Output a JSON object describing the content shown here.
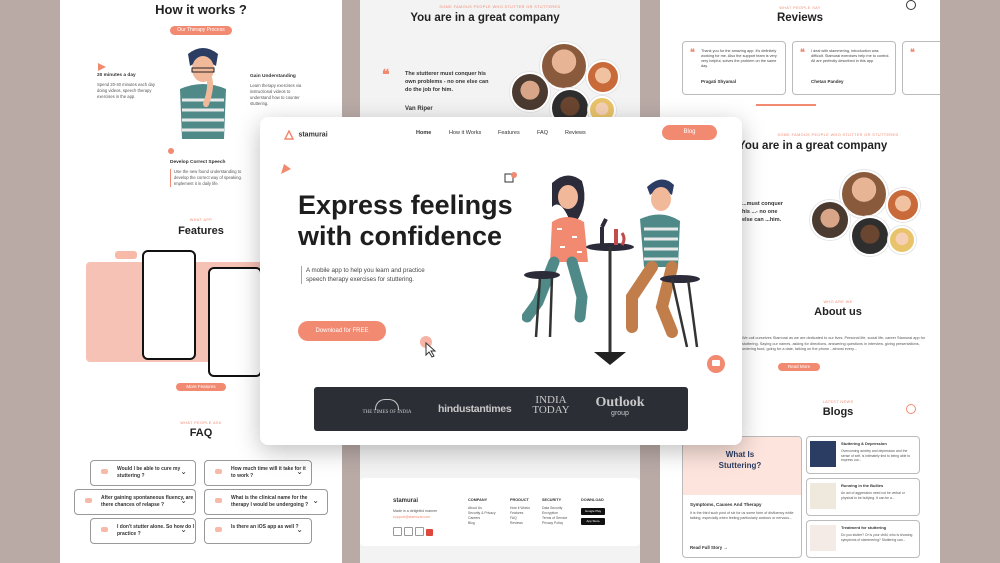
{
  "left": {
    "how_title": "How it works ?",
    "how_pill": "Our Therapy Process",
    "steps": [
      {
        "title": "20 minutes a day",
        "text": "Spend 20-40 minutes each day doing videos, speech therapy exercises in the app."
      },
      {
        "title": "Gain Understanding",
        "text": "Learn therapy exercises via instructional videos to understand how to counter stuttering."
      },
      {
        "title": "Develop Correct Speech",
        "text": "Use the new found understanding to develop the correct way of speaking. Implement it in daily life."
      }
    ],
    "features_eyebrow": "WHAT APP",
    "features_title": "Features",
    "features_pill": "More Features",
    "faq_eyebrow": "WHAT PEOPLE ASK",
    "faq_title": "FAQ",
    "faq": [
      "Would I be able to cure my stuttering ?",
      "How much time will it take for it to work ?",
      "After gaining spontaneous fluency, are there chances of relapse ?",
      "What is the clinical name for the therapy I would be undergoing ?",
      "I don't stutter alone. So how do I practice ?",
      "Is there an iOS app as well ?"
    ]
  },
  "mid": {
    "eyebrow": "SOME FAMOUS PEOPLE WHO STUTTER OR STUTTERED",
    "title": "You are in a great company",
    "quote": "The stutterer must conquer his own problems - no one else can do the job for him.",
    "author": "Van Riper",
    "footer": {
      "brand": "stamurai",
      "about": "Made in a delightful manner",
      "email": "support@stamurai.com",
      "columns": [
        {
          "title": "COMPANY",
          "links": [
            "About Us",
            "Security & Privacy",
            "Careers",
            "Blog"
          ]
        },
        {
          "title": "PRODUCT",
          "links": [
            "How it Works",
            "Features",
            "FAQ",
            "Reviews"
          ]
        },
        {
          "title": "SECURITY",
          "links": [
            "Data Security",
            "Encryption",
            "Terms of Service",
            "Privacy Policy"
          ]
        },
        {
          "title": "DOWNLOAD",
          "links": [
            "Google Play",
            "App Store"
          ]
        }
      ],
      "social": [
        "f",
        "t",
        "in",
        "yt"
      ]
    }
  },
  "right": {
    "reviews_eyebrow": "WHAT PEOPLE SAY",
    "reviews_title": "Reviews",
    "reviews": [
      {
        "text": "Thank you for the amazing app. It's definitely working for me. Also the support team is very very helpful, solves the problem on the same day.",
        "name": "Pragati Shyamal"
      },
      {
        "text": "I deal with stammering, introduction was difficult. Stamurai exercises help me to control. All are perfectly described in this app.",
        "name": "Chetan Pandey"
      },
      {
        "text": "",
        "name": ""
      }
    ],
    "company_eyebrow": "SOME FAMOUS PEOPLE WHO STUTTER OR STUTTERED",
    "company_title": "You are in a great company",
    "company_quote": "...must conquer his ...- no one else can ...him.",
    "about_eyebrow": "WHO ARE WE",
    "about_title": "About us",
    "about_text": "We call ourselves Stamurai as we are dedicated to our lives. Personal life, social life, career Stamurai app for stuttering. Saying our names, asking for directions, answering questions in interview, giving presentations, ordering food, going for a date, talking on the phone - almost every...",
    "about_pill": "Read More",
    "blogs_eyebrow": "LATEST NEWS",
    "blogs_title": "Blogs",
    "featured_blog": {
      "banner": "What Is Stuttering?",
      "title": "Symptoms, Causes And Therapy",
      "text": "It is the third such post of six for us some form of disfluency while talking, especially when feeling particularly anxious or nervous...",
      "link": "Read Full Story →"
    },
    "blogs": [
      {
        "title": "Stuttering & Depression",
        "text": "Overcoming anxiety and depression and the sense of self, is intimately tied to being able to express our..."
      },
      {
        "title": "Running in the Bullies",
        "text": "An act of aggression need not be verbal or physical to be bullying. It can be a..."
      },
      {
        "title": "Treatment for stuttering",
        "text": "Do you stutter? Or is your child, who is showing symptoms of stammering? Stuttering can..."
      }
    ]
  },
  "hero": {
    "brand": "stamurai",
    "nav": [
      "Home",
      "How it Works",
      "Features",
      "FAQ",
      "Reviews"
    ],
    "nav_button": "Blog",
    "title_line1": "Express feelings",
    "title_line2": "with confidence",
    "subtitle": "A mobile app to help you learn and practice speech therapy exercises for stuttering.",
    "cta": "Download for FREE",
    "press": [
      "THE TIMES OF INDIA",
      "hindustantimes",
      "INDIA TODAY",
      "Outlook"
    ],
    "press_sub": "group"
  },
  "colors": {
    "accent": "#f28a72",
    "dark": "#2c2e36",
    "pink": "#f7c2b6"
  }
}
